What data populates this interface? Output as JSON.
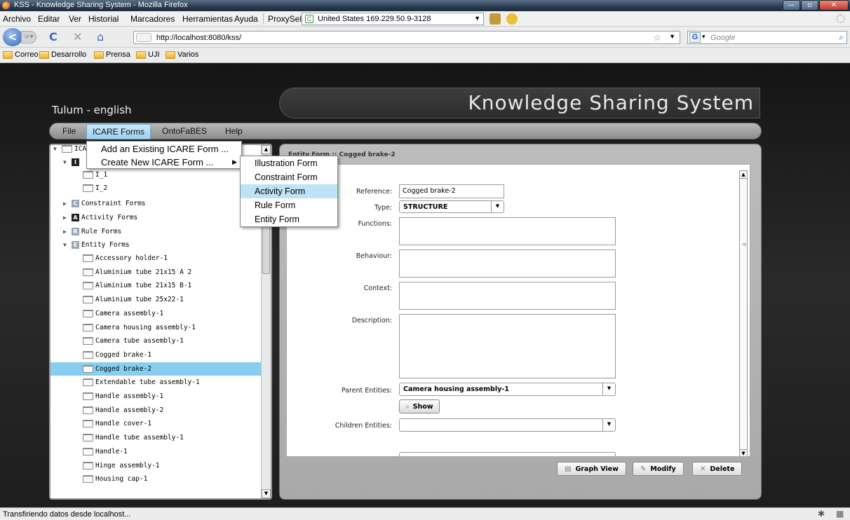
{
  "browser": {
    "window_title": "KSS - Knowledge Sharing System - Mozilla Firefox",
    "menu": [
      "Archivo",
      "Editar",
      "Ver",
      "Historial",
      "Marcadores",
      "Herramientas",
      "Ayuda"
    ],
    "proxy_label": "ProxySel",
    "proxy_value": "United States 169.229.50.9-3128",
    "url": "http://localhost:8080/kss/",
    "search_placeholder": "Google",
    "bookmarks": [
      "Correo",
      "Desarrollo",
      "Prensa",
      "UJI",
      "Varios"
    ],
    "status_text": "Transfiriendo datos desde localhost..."
  },
  "app": {
    "user": "Tulum - english",
    "title": "Knowledge Sharing System",
    "menu": [
      "File",
      "ICARE Forms",
      "OntoFaBES",
      "Help"
    ],
    "active_menu": "ICARE Forms"
  },
  "menu_dropdown": {
    "add_existing": "Add an Existing ICARE Form ...",
    "create_new": "Create New ICARE Form ...",
    "submenu": [
      "Illustration Form",
      "Constraint Form",
      "Activity Form",
      "Rule Form",
      "Entity Form"
    ],
    "highlighted": "Activity Form"
  },
  "tree": {
    "root": "ICARE",
    "illustration_children": [
      "I_1",
      "I_2"
    ],
    "categories": [
      {
        "badge": "C",
        "label": "Constraint Forms",
        "color": "#9aa6b4"
      },
      {
        "badge": "A",
        "label": "Activity Forms",
        "color": "#1f1f1f"
      },
      {
        "badge": "R",
        "label": "Rule Forms",
        "color": "#9aa6b4"
      },
      {
        "badge": "E",
        "label": "Entity Forms",
        "color": "#9aa6b4"
      }
    ],
    "entities": [
      "Accessory holder-1",
      "Aluminium tube 21x15 A 2",
      "Aluminium tube 21x15 B-1",
      "Aluminium tube 25x22-1",
      "Camera assembly-1",
      "Camera housing assembly-1",
      "Camera tube assembly-1",
      "Cogged brake-1",
      "Cogged brake-2",
      "Extendable tube assembly-1",
      "Handle assembly-1",
      "Handle assembly-2",
      "Handle cover-1",
      "Handle tube assembly-1",
      "Handle-1",
      "Hinge assembly-1",
      "Housing cap-1"
    ],
    "selected": "Cogged brake-2"
  },
  "form": {
    "panel_title": "Entity Form :: Cogged brake-2",
    "labels": {
      "reference": "Reference:",
      "type": "Type:",
      "functions": "Functions:",
      "behaviour": "Behaviour:",
      "context": "Context:",
      "description": "Description:",
      "parent": "Parent Entities:",
      "children": "Children Entities:"
    },
    "reference": "Cogged brake-2",
    "type": "STRUCTURE",
    "parent": "Camera housing assembly-1",
    "children": "",
    "show_button": "Show",
    "buttons": {
      "graph": "Graph View",
      "modify": "Modify",
      "delete": "Delete"
    }
  }
}
